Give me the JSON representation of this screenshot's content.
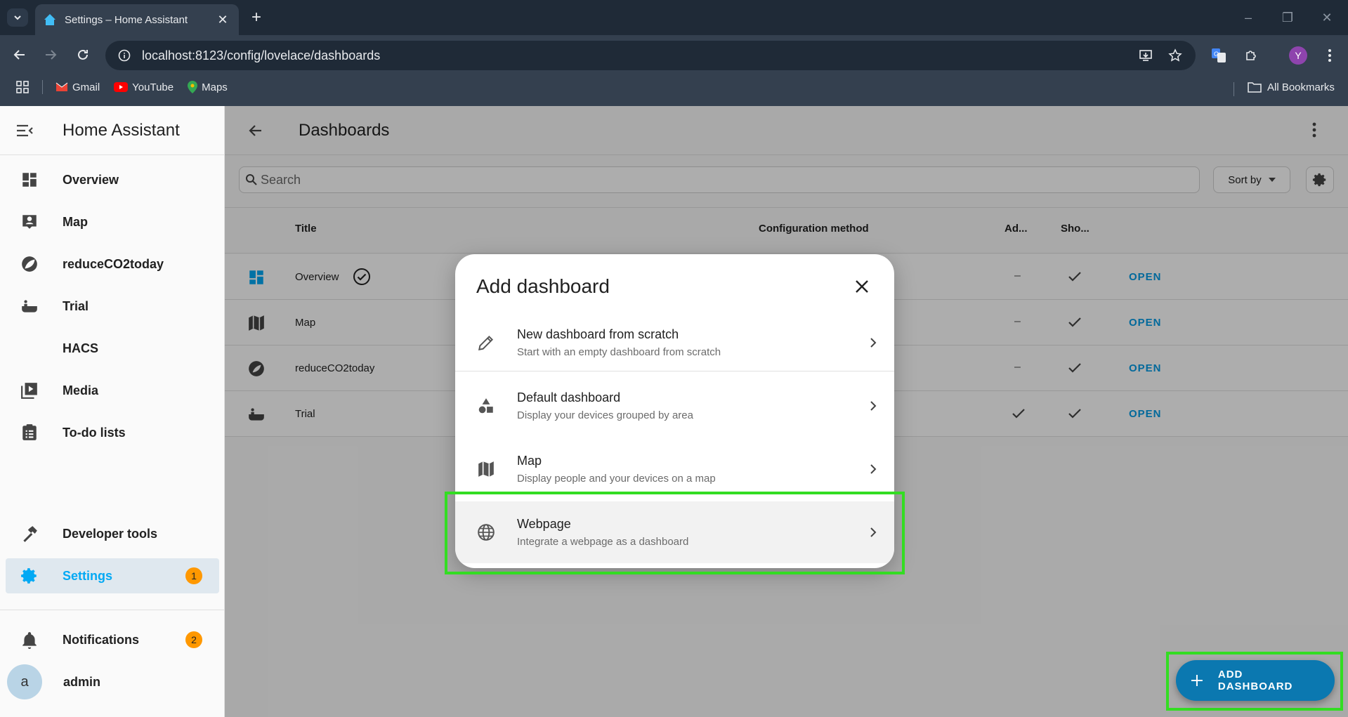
{
  "browser": {
    "tab_title": "Settings – Home Assistant",
    "url": "localhost:8123/config/lovelace/dashboards",
    "profile_initial": "Y",
    "bookmarks": [
      "Gmail",
      "YouTube",
      "Maps"
    ],
    "all_bookmarks": "All Bookmarks"
  },
  "sidebar": {
    "title": "Home Assistant",
    "items": [
      {
        "label": "Overview",
        "icon": "dashboard-icon"
      },
      {
        "label": "Map",
        "icon": "map-account-icon"
      },
      {
        "label": "reduceCO2today",
        "icon": "leaf-icon"
      },
      {
        "label": "Trial",
        "icon": "bathtub-icon"
      },
      {
        "label": "HACS",
        "icon": "hacs-icon"
      },
      {
        "label": "Media",
        "icon": "media-icon"
      },
      {
        "label": "To-do lists",
        "icon": "clipboard-list-icon"
      }
    ],
    "developer_tools": "Developer tools",
    "settings": "Settings",
    "settings_badge": "1",
    "notifications": "Notifications",
    "notifications_badge": "2",
    "user_initial": "a",
    "user_name": "admin"
  },
  "main": {
    "title": "Dashboards",
    "search_placeholder": "Search",
    "sort_by": "Sort by",
    "columns": {
      "title": "Title",
      "config": "Configuration method",
      "admin": "Ad...",
      "show": "Sho..."
    },
    "rows": [
      {
        "title": "Overview",
        "admin": "–",
        "open": "OPEN"
      },
      {
        "title": "Map",
        "admin": "–",
        "open": "OPEN"
      },
      {
        "title": "reduceCO2today",
        "admin": "–",
        "open": "OPEN"
      },
      {
        "title": "Trial",
        "admin": "",
        "open": "OPEN"
      }
    ],
    "fab_label": "ADD DASHBOARD"
  },
  "dialog": {
    "title": "Add dashboard",
    "options": [
      {
        "name": "New dashboard from scratch",
        "desc": "Start with an empty dashboard from scratch"
      },
      {
        "name": "Default dashboard",
        "desc": "Display your devices grouped by area"
      },
      {
        "name": "Map",
        "desc": "Display people and your devices on a map"
      },
      {
        "name": "Webpage",
        "desc": "Integrate a webpage as a dashboard"
      }
    ]
  },
  "colors": {
    "accent": "#03a9f4",
    "badge": "#ff9800",
    "highlight": "#33dd22"
  }
}
